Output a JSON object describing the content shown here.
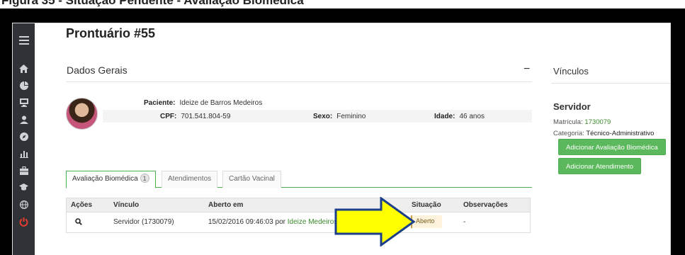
{
  "caption": "Figura 35 - Situação Pendente - Avaliação Biomédica",
  "page": {
    "title": "Prontuário #55"
  },
  "sidebar": {
    "icons": [
      "menu-icon",
      "home-icon",
      "pie-chart-icon",
      "monitor-icon",
      "user-icon",
      "compass-icon",
      "bar-chart-icon",
      "briefcase-icon",
      "graduation-cap-icon",
      "globe-icon",
      "power-icon"
    ]
  },
  "dados_gerais": {
    "title": "Dados Gerais",
    "collapse": "−",
    "paciente_label": "Paciente:",
    "paciente": "Ideize de Barros Medeiros",
    "cpf_label": "CPF:",
    "cpf": "701.541.804-59",
    "sexo_label": "Sexo:",
    "sexo": "Feminino",
    "idade_label": "Idade:",
    "idade": "46 anos"
  },
  "tabs": [
    {
      "label": "Avaliação Biomédica",
      "badge": "1",
      "active": true
    },
    {
      "label": "Atendimentos"
    },
    {
      "label": "Cartão Vacinal"
    }
  ],
  "table": {
    "headers": [
      "Ações",
      "Vínculo",
      "Aberto em",
      "Situação",
      "Observações"
    ],
    "rows": [
      {
        "acao_icon": "search-icon",
        "vinculo": "Servidor (1730079)",
        "aberto_em": "15/02/2016 09:46:03 por",
        "aberto_por": "Ideize Medeiros",
        "situacao": "Aberto",
        "observacoes": "-"
      }
    ]
  },
  "vinculos": {
    "title": "Vínculos",
    "tipo": "Servidor",
    "matricula_label": "Matrícula:",
    "matricula": "1730079",
    "categoria_label": "Categoria:",
    "categoria": "Técnico-Administrativo",
    "btn_avaliacao": "Adicionar Avaliação Biomédica",
    "btn_atendimento": "Adicionar Atendimento"
  },
  "colors": {
    "sidebar": "#2f3237",
    "accent_green": "#5cb85c",
    "link_green": "#3a8a2b",
    "arrow_fill": "#ffff00",
    "arrow_stroke": "#1c3f8a",
    "power": "#e63b2e"
  }
}
